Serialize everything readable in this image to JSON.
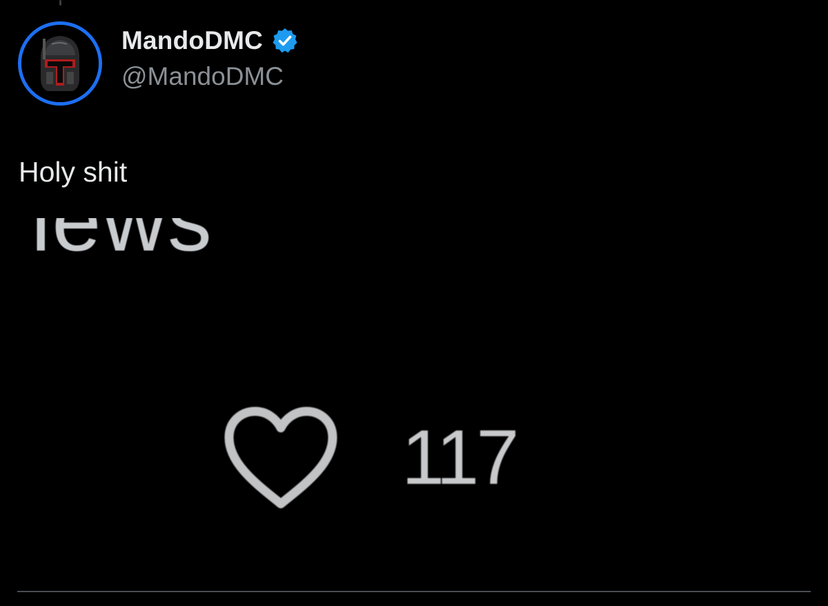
{
  "post": {
    "author": {
      "display_name": "MandoDMC",
      "handle": "@MandoDMC",
      "verified": true,
      "avatar_icon": "mandalorian-helmet-icon",
      "avatar_ring_color": "#1d6ff2"
    },
    "text": "Holy shit",
    "embedded_image": {
      "cropped_word": "news",
      "like_icon": "heart-outline-icon",
      "like_count": "117"
    }
  },
  "colors": {
    "background": "#000000",
    "primary_text": "#e7e9ea",
    "secondary_text": "#8b9196",
    "verified_badge": "#1d9bf0",
    "divider": "#4a4d51"
  }
}
